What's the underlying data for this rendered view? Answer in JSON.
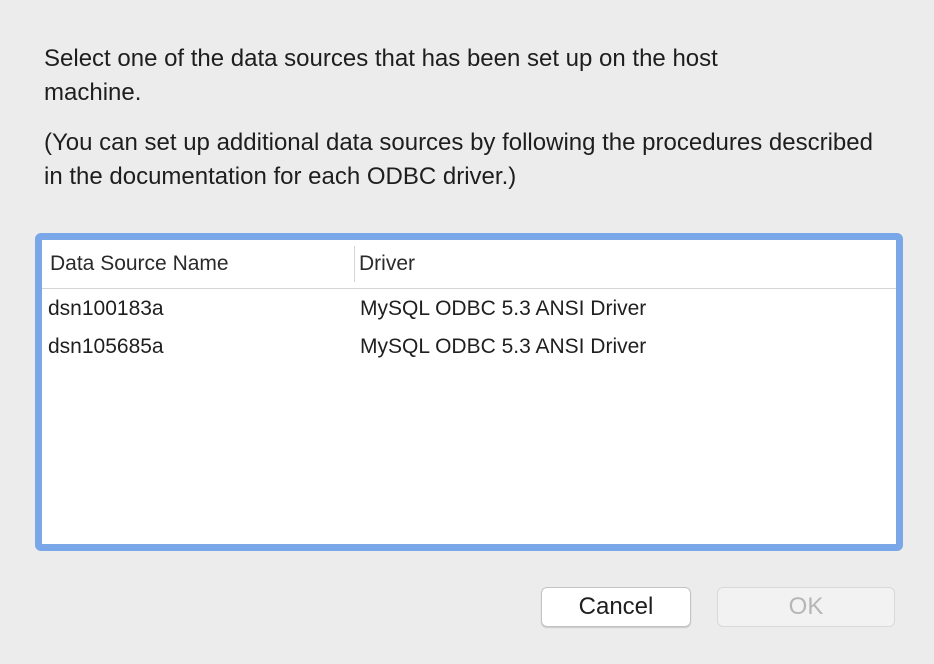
{
  "instructions": {
    "line1": "Select one of the data sources that has been set up on the host machine.",
    "line2": "(You can set up additional data sources by following the procedures described in the documentation for each ODBC driver.)"
  },
  "table": {
    "columns": [
      "Data Source Name",
      "Driver"
    ],
    "rows": [
      {
        "name": "dsn100183a",
        "driver": "MySQL ODBC 5.3 ANSI Driver"
      },
      {
        "name": "dsn105685a",
        "driver": "MySQL ODBC 5.3 ANSI Driver"
      }
    ]
  },
  "buttons": {
    "cancel_label": "Cancel",
    "ok_label": "OK"
  },
  "colors": {
    "focus_ring": "#7aa7e8",
    "window_bg": "#ececec",
    "disabled_text": "#b6b6b6"
  }
}
